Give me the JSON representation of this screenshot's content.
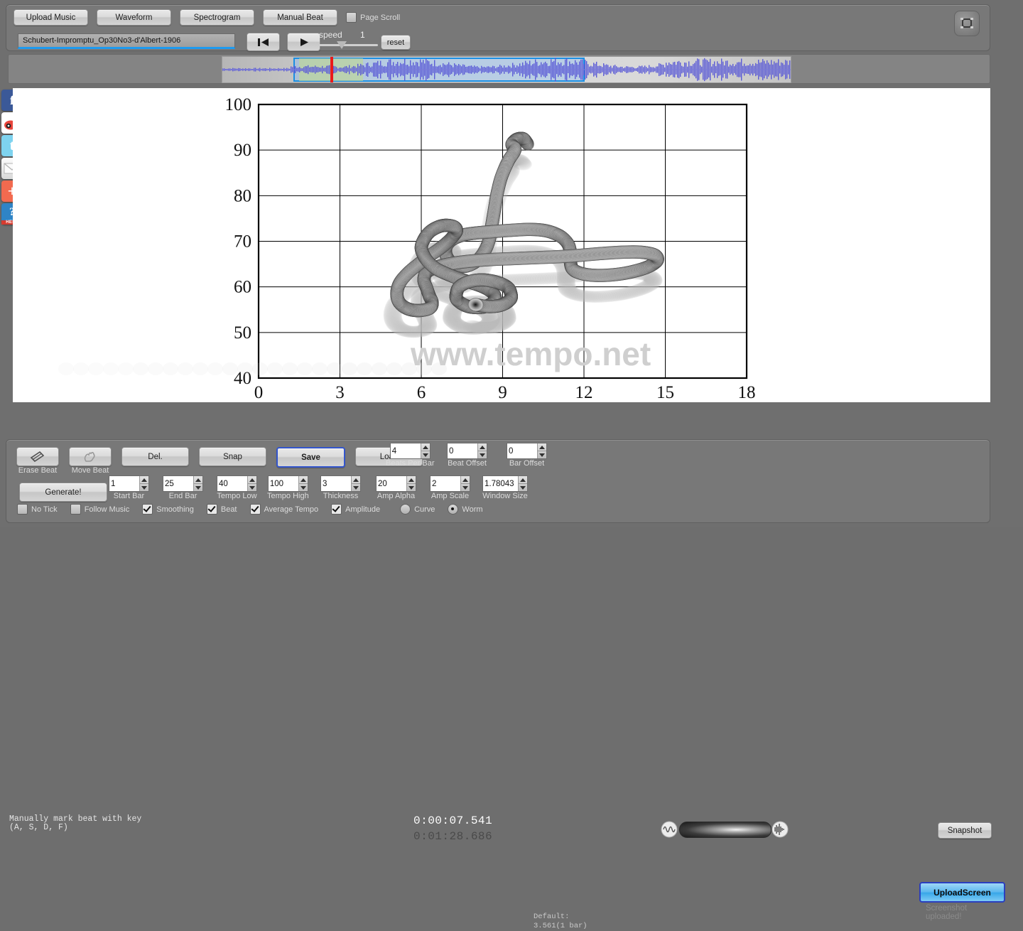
{
  "toolbar": {
    "upload_music": "Upload Music",
    "waveform": "Waveform",
    "spectrogram": "Spectrogram",
    "manual_beat": "Manual Beat",
    "page_scroll": "Page Scroll",
    "page_scroll_checked": false,
    "song_name": "Schubert-Impromptu_Op30No3-d'Albert-1906",
    "speed_label": "speed",
    "speed_value": "1",
    "reset": "reset",
    "prev_icon": "skip-back-icon",
    "play_icon": "play-icon",
    "fullscreen_icon": "fullscreen-icon"
  },
  "social": [
    {
      "name": "facebook",
      "glyph": "f"
    },
    {
      "name": "weibo",
      "glyph": "◉"
    },
    {
      "name": "twitter",
      "glyph": "t"
    },
    {
      "name": "email",
      "glyph": "✉"
    },
    {
      "name": "share-more",
      "glyph": "+"
    },
    {
      "name": "help",
      "glyph": "?",
      "sub": "HELP"
    }
  ],
  "chart_data": {
    "type": "line",
    "title": "",
    "xlabel": "",
    "ylabel": "",
    "xlim": [
      0,
      18
    ],
    "ylim": [
      40,
      100
    ],
    "xticks": [
      0,
      3,
      6,
      9,
      12,
      15,
      18
    ],
    "yticks": [
      40,
      50,
      60,
      70,
      80,
      90,
      100
    ],
    "grid": true,
    "legend": "none",
    "watermark": "www.tempo.net",
    "series": [
      {
        "name": "worm-path",
        "style": "worm",
        "points": [
          [
            9.9,
            91.5
          ],
          [
            9.75,
            92.5
          ],
          [
            9.5,
            92.3
          ],
          [
            9.35,
            91.2
          ],
          [
            9.45,
            90.0
          ],
          [
            9.2,
            87.5
          ],
          [
            8.95,
            84.0
          ],
          [
            8.8,
            80.5
          ],
          [
            8.7,
            77.0
          ],
          [
            8.6,
            73.5
          ],
          [
            8.5,
            70.2
          ],
          [
            8.3,
            67.5
          ],
          [
            8.0,
            65.5
          ],
          [
            7.6,
            64.5
          ],
          [
            7.2,
            65.0
          ],
          [
            6.95,
            66.5
          ],
          [
            6.9,
            68.5
          ],
          [
            7.1,
            70.2
          ],
          [
            7.5,
            71.3
          ],
          [
            8.0,
            71.8
          ],
          [
            8.6,
            72.1
          ],
          [
            9.3,
            72.4
          ],
          [
            10.0,
            72.6
          ],
          [
            10.6,
            72.3
          ],
          [
            11.1,
            71.2
          ],
          [
            11.4,
            69.5
          ],
          [
            11.5,
            67.5
          ],
          [
            11.5,
            65.5
          ],
          [
            11.6,
            63.8
          ],
          [
            12.0,
            62.8
          ],
          [
            12.6,
            62.5
          ],
          [
            13.3,
            62.8
          ],
          [
            13.9,
            63.5
          ],
          [
            14.4,
            64.5
          ],
          [
            14.7,
            65.8
          ],
          [
            14.6,
            67.0
          ],
          [
            14.1,
            67.6
          ],
          [
            13.4,
            67.6
          ],
          [
            12.6,
            67.3
          ],
          [
            11.8,
            66.9
          ],
          [
            11.0,
            66.6
          ],
          [
            10.2,
            66.4
          ],
          [
            9.4,
            66.2
          ],
          [
            8.6,
            66.0
          ],
          [
            7.9,
            65.7
          ],
          [
            7.2,
            65.2
          ],
          [
            6.6,
            64.4
          ],
          [
            6.2,
            63.2
          ],
          [
            6.1,
            61.5
          ],
          [
            6.2,
            59.7
          ],
          [
            6.3,
            58.0
          ],
          [
            6.4,
            56.5
          ],
          [
            6.3,
            55.3
          ],
          [
            5.9,
            54.8
          ],
          [
            5.5,
            55.2
          ],
          [
            5.2,
            56.5
          ],
          [
            5.1,
            58.5
          ],
          [
            5.2,
            60.8
          ],
          [
            5.5,
            63.0
          ],
          [
            5.9,
            65.0
          ],
          [
            6.3,
            66.8
          ],
          [
            6.7,
            68.5
          ],
          [
            7.0,
            70.0
          ],
          [
            7.2,
            71.3
          ],
          [
            7.3,
            72.4
          ],
          [
            7.2,
            73.2
          ],
          [
            6.9,
            73.5
          ],
          [
            6.6,
            73.1
          ],
          [
            6.3,
            72.0
          ],
          [
            6.1,
            70.4
          ],
          [
            6.0,
            68.6
          ],
          [
            6.1,
            66.8
          ],
          [
            6.3,
            65.2
          ],
          [
            6.6,
            63.8
          ],
          [
            7.0,
            62.7
          ],
          [
            7.4,
            61.8
          ],
          [
            7.8,
            61.0
          ],
          [
            8.2,
            60.2
          ],
          [
            8.5,
            59.3
          ],
          [
            8.7,
            58.2
          ],
          [
            8.7,
            57.0
          ],
          [
            8.5,
            56.0
          ],
          [
            8.2,
            55.5
          ],
          [
            7.8,
            55.6
          ],
          [
            7.5,
            56.3
          ],
          [
            7.3,
            57.4
          ],
          [
            7.3,
            58.7
          ],
          [
            7.4,
            60.0
          ],
          [
            7.7,
            61.0
          ],
          [
            8.1,
            61.5
          ],
          [
            8.5,
            61.4
          ],
          [
            8.9,
            60.8
          ],
          [
            9.2,
            59.8
          ],
          [
            9.3,
            58.6
          ],
          [
            9.3,
            57.4
          ],
          [
            9.1,
            56.4
          ],
          [
            8.8,
            55.8
          ],
          [
            8.4,
            55.7
          ],
          [
            8.0,
            56.1
          ]
        ]
      }
    ]
  },
  "status": {
    "hint_line1": "Manually mark beat with key",
    "hint_line2": "(A, S, D, F)",
    "time_current": "0:00:07.541",
    "time_total": "0:01:28.686",
    "volume_icon_left": "waveform-small-icon",
    "volume_icon_right": "waveform-loud-icon",
    "snapshot": "Snapshot"
  },
  "bottom": {
    "erase_beat": "Erase Beat",
    "erase_icon": "eraser-icon",
    "move_beat": "Move Beat",
    "move_icon": "hand-move-icon",
    "del": "Del.",
    "snap": "Snap",
    "save": "Save",
    "load": "Load",
    "generate": "Generate!",
    "fields": [
      {
        "label": "Start Bar",
        "value": "1"
      },
      {
        "label": "End Bar",
        "value": "25"
      },
      {
        "label": "Tempo Low",
        "value": "40"
      },
      {
        "label": "Tempo High",
        "value": "100"
      },
      {
        "label": "Thickness",
        "value": "3"
      },
      {
        "label": "Amp Alpha",
        "value": "20"
      },
      {
        "label": "Amp Scale",
        "value": "2"
      },
      {
        "label": "Window Size",
        "value": "1.78043"
      }
    ],
    "top_fields": [
      {
        "label": "Beats Per Bar",
        "value": "4"
      },
      {
        "label": "Beat Offset",
        "value": "0"
      },
      {
        "label": "Bar Offset",
        "value": "0"
      }
    ],
    "default_line1": "Default:",
    "default_line2": "3.561(1 bar)",
    "checkboxes": [
      {
        "label": "No Tick",
        "checked": false
      },
      {
        "label": "Follow Music",
        "checked": false
      },
      {
        "label": "Smoothing",
        "checked": true
      },
      {
        "label": "Beat",
        "checked": true
      },
      {
        "label": "Average Tempo",
        "checked": true
      },
      {
        "label": "Amplitude",
        "checked": true
      }
    ],
    "radios": [
      {
        "label": "Curve",
        "selected": false
      },
      {
        "label": "Worm",
        "selected": true
      }
    ],
    "upload_screen": "UploadScreen",
    "upload_note": "Screenshot uploaded!"
  },
  "colors": {
    "accent_blue": "#1e9bf0",
    "selection_blue": "#1a8fe3",
    "playhead_red": "#ea1a1a",
    "panel_gray": "#787878",
    "bg_gray": "#6f6f6f"
  }
}
